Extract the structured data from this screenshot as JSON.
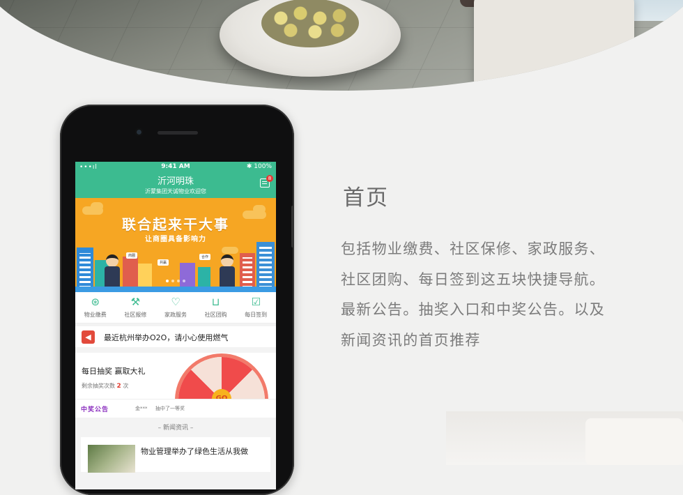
{
  "phone": {
    "status": {
      "signal": "•••ıl",
      "time": "9:41 AM",
      "battery": "100%"
    },
    "header": {
      "title": "沂河明珠",
      "subtitle": "沂蒙集团天诚物业欢迎您",
      "message_badge": "8"
    },
    "banner": {
      "headline": "联合起来干大事",
      "subheadline": "让商圈具备影响力"
    },
    "nav": [
      {
        "label": "物业缴费",
        "icon": "money-bag-icon"
      },
      {
        "label": "社区报修",
        "icon": "wrench-icon"
      },
      {
        "label": "家政服务",
        "icon": "heart-icon"
      },
      {
        "label": "社区团购",
        "icon": "shopping-bag-icon"
      },
      {
        "label": "每日签到",
        "icon": "checkbox-icon"
      }
    ],
    "notice": {
      "text": "最近杭州举办O2O，请小心使用燃气"
    },
    "lottery": {
      "title": "每日抽奖 赢取大礼",
      "remaining_label": "剩余抽奖次数",
      "remaining_count": "2",
      "remaining_unit": "次",
      "wheel_center": "GO"
    },
    "winner": {
      "label": "中奖公告",
      "name": "金***",
      "message": "抽中了一等奖"
    },
    "news": {
      "heading": "– 新闻资讯 –",
      "items": [
        {
          "title": "物业管理举办了绿色生活从我做"
        }
      ]
    }
  },
  "section": {
    "title": "首页",
    "description": "包括物业缴费、社区保修、家政服务、社区团购、每日签到这五块快捷导航。最新公告。抽奖入口和中奖公告。以及新闻资讯的首页推荐"
  },
  "colors": {
    "accent": "#3cbb90",
    "banner": "#f6a623",
    "alert": "#e24a3b"
  }
}
